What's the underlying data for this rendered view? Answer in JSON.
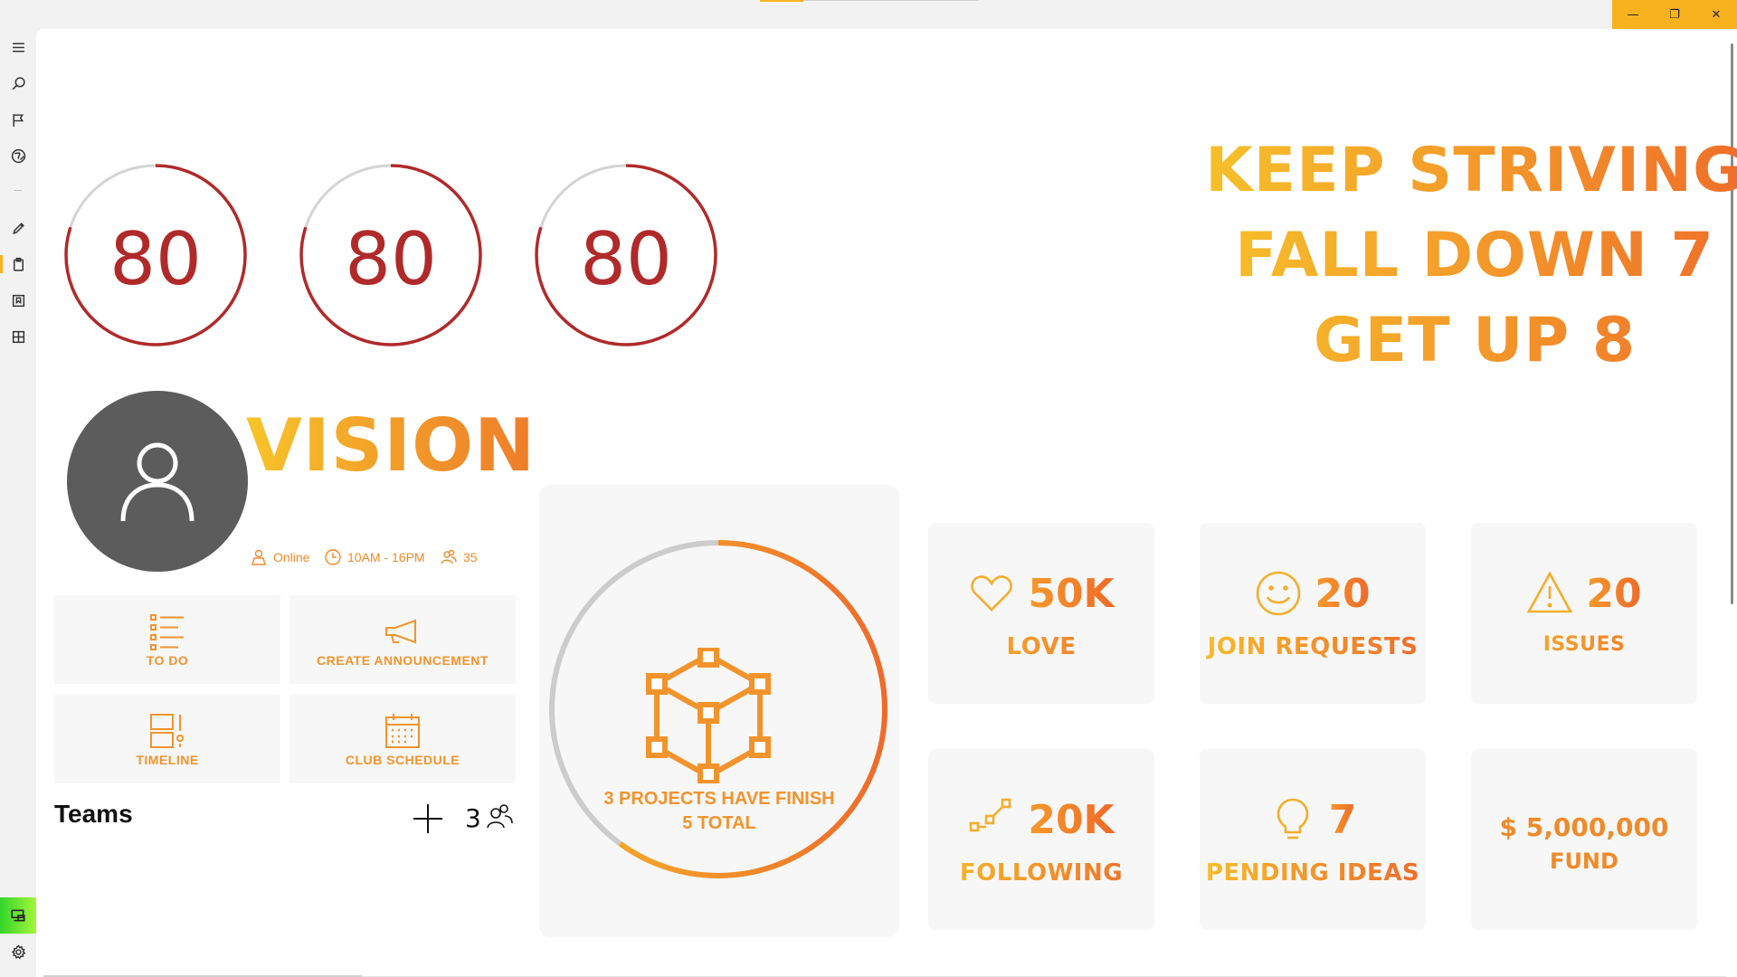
{
  "window": {
    "caption": {
      "minimize": "—",
      "restore": "❐",
      "close": "✕"
    }
  },
  "rail": {
    "items": [
      {
        "name": "menu",
        "icon": "hamburger-icon"
      },
      {
        "name": "search",
        "icon": "search-icon"
      },
      {
        "name": "flag",
        "icon": "flag-icon"
      },
      {
        "name": "globe",
        "icon": "globe-icon"
      },
      {
        "name": "edit",
        "icon": "pencil-icon"
      },
      {
        "name": "clipboard",
        "icon": "clipboard-icon"
      },
      {
        "name": "bookmark",
        "icon": "bookmark-icon"
      },
      {
        "name": "grid",
        "icon": "grid-icon"
      },
      {
        "name": "device",
        "icon": "device-icon"
      },
      {
        "name": "settings",
        "icon": "gear-icon"
      }
    ]
  },
  "rings": [
    {
      "value": "80",
      "progress": 0.8
    },
    {
      "value": "80",
      "progress": 0.8
    },
    {
      "value": "80",
      "progress": 0.8
    }
  ],
  "quote": {
    "line1": "KEEP STRIVING",
    "line2": "FALL DOWN 7",
    "line3": "GET UP 8"
  },
  "profile": {
    "title": "VISION",
    "status": "Online",
    "hours": "10AM - 16PM",
    "members": "35"
  },
  "actions": {
    "todo": "TO DO",
    "announcement": "CREATE ANNOUNCEMENT",
    "timeline": "TIMELINE",
    "schedule": "CLUB SCHEDULE"
  },
  "teams": {
    "title": "Teams",
    "count": "3"
  },
  "projects": {
    "line1": "3 PROJECTS HAVE FINISH",
    "line2": "5 TOTAL",
    "progress": 0.6
  },
  "stats": {
    "love": {
      "value": "50K",
      "label": "LOVE"
    },
    "join": {
      "value": "20",
      "label": "JOIN REQUESTS"
    },
    "issues": {
      "value": "20",
      "label": "ISSUES"
    },
    "following": {
      "value": "20K",
      "label": "FOLLOWING"
    },
    "ideas": {
      "value": "7",
      "label": "PENDING IDEAS"
    },
    "fund": {
      "value": "$  5,000,000",
      "label": "FUND"
    }
  },
  "colors": {
    "accent": "#f7b21d",
    "ring_red": "#b02a2a",
    "orange": "#f3932c",
    "gradient_start": "#f8c42a",
    "gradient_end": "#ef6a2a"
  }
}
